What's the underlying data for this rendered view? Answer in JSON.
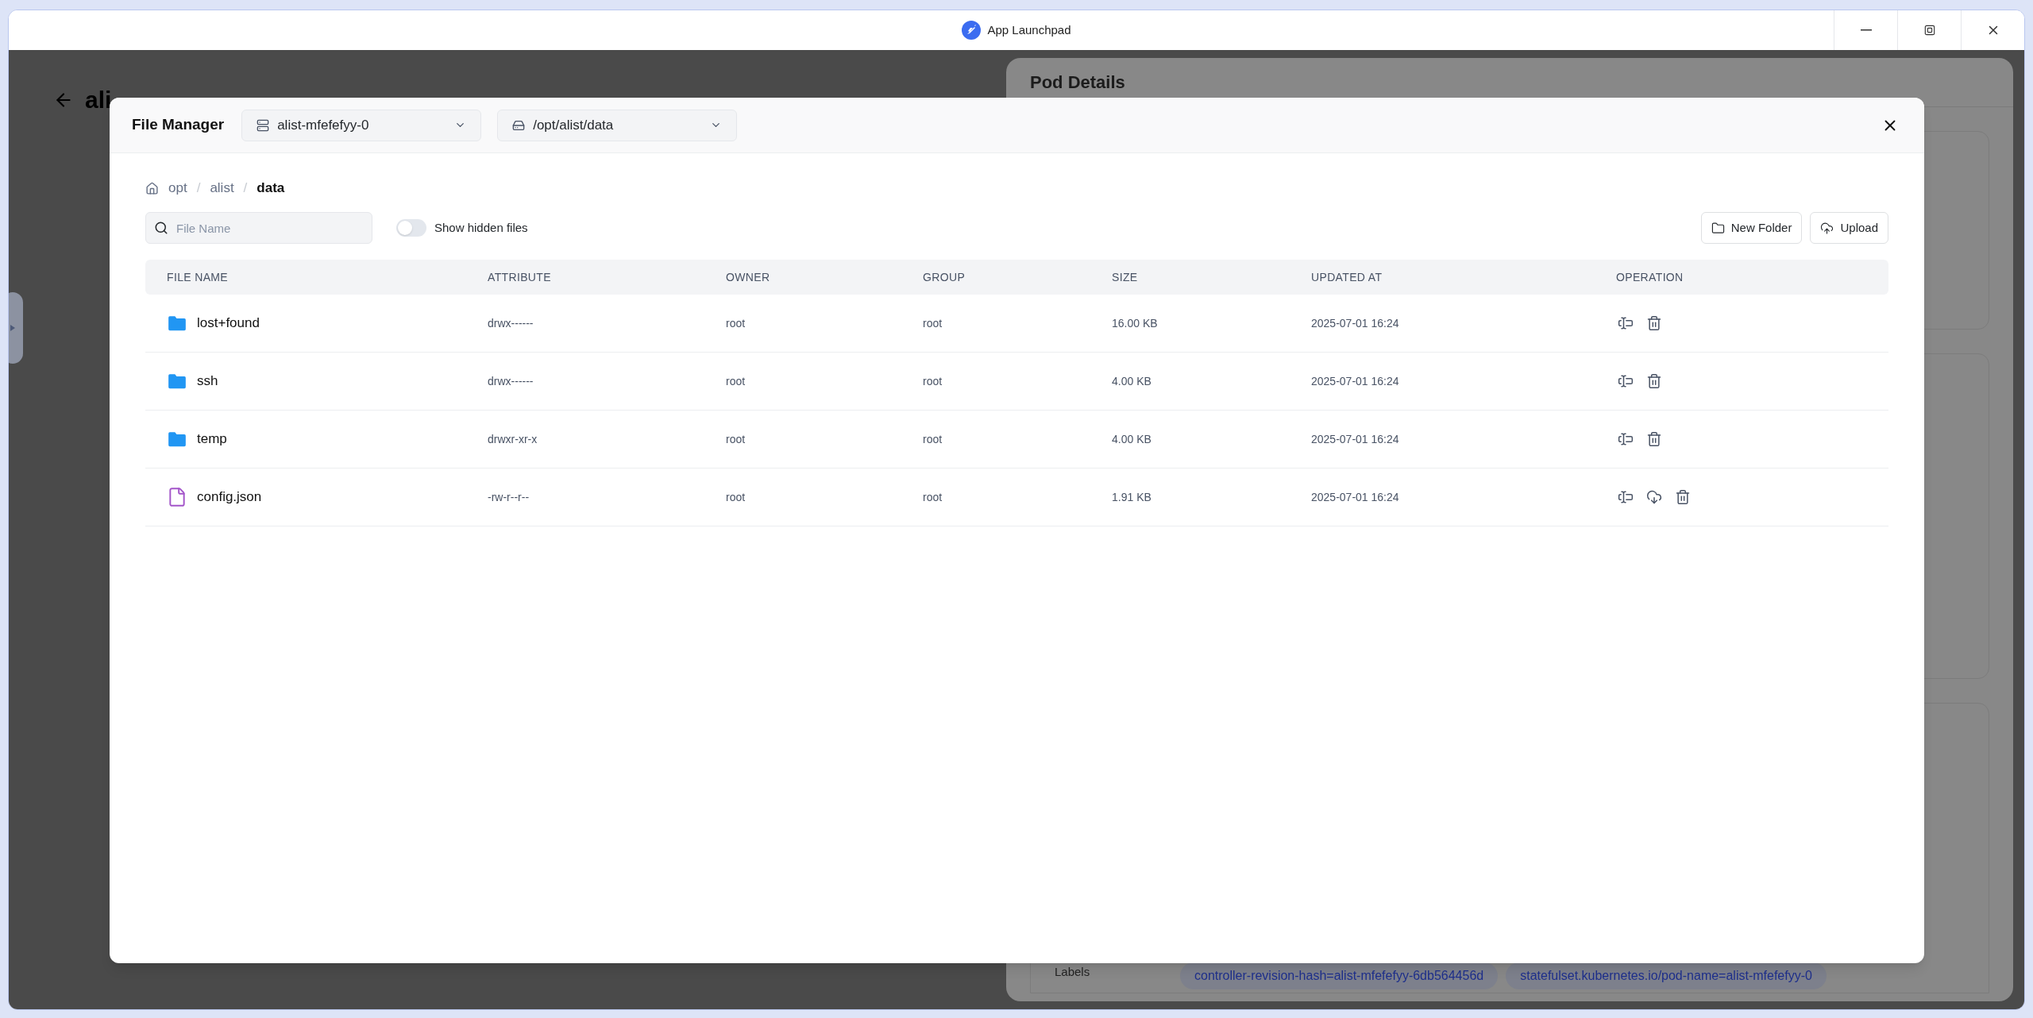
{
  "window": {
    "title": "App Launchpad"
  },
  "background": {
    "back_title": "ali",
    "panel_title": "Pod Details",
    "labels_caption": "Labels",
    "labels": [
      "controller-revision-hash=alist-mfefefyy-6db564456d",
      "statefulset.kubernetes.io/pod-name=alist-mfefefyy-0"
    ]
  },
  "file_manager": {
    "title": "File Manager",
    "pod_select": "alist-mfefefyy-0",
    "path_select": "/opt/alist/data",
    "breadcrumb_separator": "/",
    "breadcrumb": [
      {
        "label": "opt",
        "selected": false
      },
      {
        "label": "alist",
        "selected": false
      },
      {
        "label": "data",
        "selected": true
      }
    ],
    "search": {
      "placeholder": "File Name"
    },
    "show_hidden": {
      "label": "Show hidden files",
      "on": false
    },
    "buttons": [
      {
        "kind": "new_folder",
        "label": "New Folder"
      },
      {
        "kind": "upload",
        "label": "Upload"
      }
    ],
    "columns": [
      "FILE NAME",
      "ATTRIBUTE",
      "OWNER",
      "GROUP",
      "SIZE",
      "UPDATED AT",
      "OPERATION"
    ],
    "rows": [
      {
        "kind": "folder",
        "name": "lost+found",
        "attribute": "drwx------",
        "owner": "root",
        "group": "root",
        "size": "16.00 KB",
        "updated_at": "2025-07-01 16:24",
        "actions": [
          {
            "kind": "rename"
          },
          {
            "kind": "delete"
          }
        ]
      },
      {
        "kind": "folder",
        "name": "ssh",
        "attribute": "drwx------",
        "owner": "root",
        "group": "root",
        "size": "4.00 KB",
        "updated_at": "2025-07-01 16:24",
        "actions": [
          {
            "kind": "rename"
          },
          {
            "kind": "delete"
          }
        ]
      },
      {
        "kind": "folder",
        "name": "temp",
        "attribute": "drwxr-xr-x",
        "owner": "root",
        "group": "root",
        "size": "4.00 KB",
        "updated_at": "2025-07-01 16:24",
        "actions": [
          {
            "kind": "rename"
          },
          {
            "kind": "delete"
          }
        ]
      },
      {
        "kind": "file",
        "name": "config.json",
        "attribute": "-rw-r--r--",
        "owner": "root",
        "group": "root",
        "size": "1.91 KB",
        "updated_at": "2025-07-01 16:24",
        "actions": [
          {
            "kind": "rename"
          },
          {
            "kind": "download"
          },
          {
            "kind": "delete"
          }
        ]
      }
    ]
  }
}
